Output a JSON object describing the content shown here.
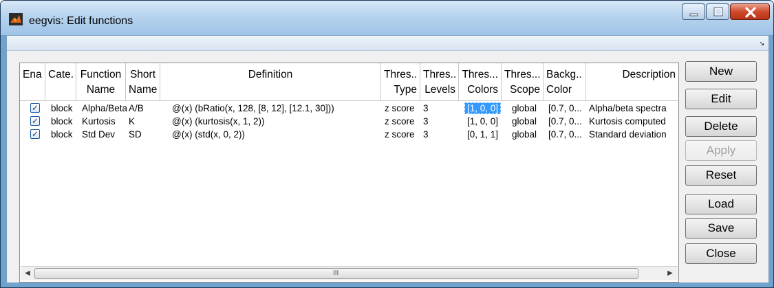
{
  "window": {
    "title": "eegvis: Edit functions"
  },
  "table": {
    "columns": [
      {
        "line1": "Ena...",
        "line2": ""
      },
      {
        "line1": "Cate...",
        "line2": ""
      },
      {
        "line1": "Function",
        "line2": "Name"
      },
      {
        "line1": "Short",
        "line2": "Name"
      },
      {
        "line1": "Definition",
        "line2": ""
      },
      {
        "line1": "Thres...",
        "line2": "Type"
      },
      {
        "line1": "Thres...",
        "line2": "Levels"
      },
      {
        "line1": "Thres...",
        "line2": "Colors"
      },
      {
        "line1": "Thres...",
        "line2": "Scope"
      },
      {
        "line1": "Backg...",
        "line2": "Color"
      },
      {
        "line1": "Description",
        "line2": ""
      }
    ],
    "rows": [
      {
        "enabled": "✓",
        "category": "block",
        "name": "Alpha/Beta",
        "short": "A/B",
        "definition": "@(x) (bRatio(x, 128, [8, 12], [12.1, 30]))",
        "ttype": "z score",
        "levels": "3",
        "colors": "[1, 0, 0]",
        "scope": "global",
        "bg": "[0.7, 0...",
        "desc": "Alpha/beta spectra"
      },
      {
        "enabled": "✓",
        "category": "block",
        "name": "Kurtosis",
        "short": "K",
        "definition": "@(x) (kurtosis(x, 1, 2))",
        "ttype": "z score",
        "levels": "3",
        "colors": "[1, 0, 0]",
        "scope": "global",
        "bg": "[0.7, 0...",
        "desc": "Kurtosis computed"
      },
      {
        "enabled": "✓",
        "category": "block",
        "name": "Std Dev",
        "short": "SD",
        "definition": "@(x) (std(x, 0, 2))",
        "ttype": "z score",
        "levels": "3",
        "colors": "[0, 1, 1]",
        "scope": "global",
        "bg": "[0.7, 0...",
        "desc": "Standard deviation"
      }
    ],
    "selected_cell": {
      "row": 0,
      "column": "colors"
    },
    "scroll_grip": "III"
  },
  "buttons": {
    "new": "New",
    "edit": "Edit",
    "delete": "Delete",
    "apply": "Apply",
    "reset": "Reset",
    "load": "Load",
    "save": "Save",
    "close": "Close"
  },
  "colors": {
    "selection": "#3399ff",
    "titlebar": "#b7d3ee",
    "close_button": "#cf4a2c"
  }
}
